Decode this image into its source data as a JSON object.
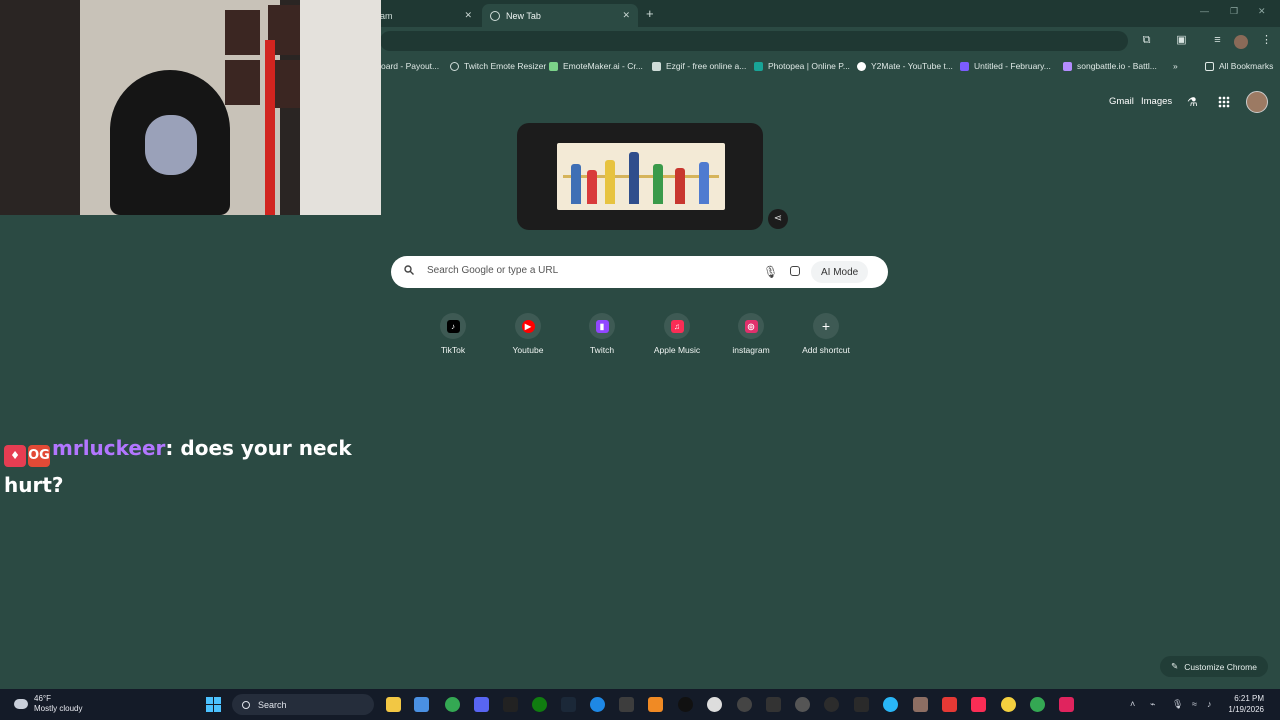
{
  "browser": {
    "tabs": [
      {
        "label": "am",
        "active": false
      },
      {
        "label": "New Tab",
        "active": true
      }
    ],
    "bookmarks": [
      {
        "label": "oard - Payout...",
        "icon": "doc-icon",
        "color": "#8ab4f8"
      },
      {
        "label": "Twitch Emote Resizer",
        "icon": "globe-icon",
        "color": "#cfdcd8"
      },
      {
        "label": "EmoteMaker.ai - Cr...",
        "icon": "emotemaker-icon",
        "color": "#7bd389"
      },
      {
        "label": "Ezgif - free online a...",
        "icon": "ezgif-icon",
        "color": "#cfdcd8"
      },
      {
        "label": "Photopea | Online P...",
        "icon": "photopea-icon",
        "color": "#18a497"
      },
      {
        "label": "Y2Mate - YouTube t...",
        "icon": "y2mate-icon",
        "color": "#ffffff"
      },
      {
        "label": "Untitled - February...",
        "icon": "canva-icon",
        "color": "#7c5cff"
      },
      {
        "label": "songbattle.io - Battl...",
        "icon": "songbattle-icon",
        "color": "#b48cff"
      }
    ],
    "all_bookmarks": "All Bookmarks",
    "more_chevron": "»"
  },
  "ntp": {
    "gmail": "Gmail",
    "images": "Images",
    "search_placeholder": "Search Google or type a URL",
    "ai_mode": "AI Mode",
    "shortcuts": [
      {
        "label": "TikTok",
        "icon": "tiktok-icon",
        "glyph": "♪",
        "color": "#000000"
      },
      {
        "label": "Youtube",
        "icon": "youtube-icon",
        "glyph": "▶",
        "color": "#ff0000"
      },
      {
        "label": "Twitch",
        "icon": "twitch-icon",
        "glyph": "▮",
        "color": "#9146ff"
      },
      {
        "label": "Apple Music",
        "icon": "apple-music-icon",
        "glyph": "♫",
        "color": "#fa2d55"
      },
      {
        "label": "instagram",
        "icon": "instagram-icon",
        "glyph": "◎",
        "color": "#e1306c"
      },
      {
        "label": "Add shortcut",
        "icon": "plus-icon",
        "glyph": "+",
        "color": "transparent"
      }
    ],
    "customize": "Customize Chrome"
  },
  "chat": {
    "badge_og": "OG",
    "username": "mrluckeer",
    "message": ": does your neck hurt?"
  },
  "taskbar": {
    "temperature": "46°F",
    "weather": "Mostly cloudy",
    "search": "Search",
    "time": "6:21 PM",
    "date": "1/19/2026"
  }
}
